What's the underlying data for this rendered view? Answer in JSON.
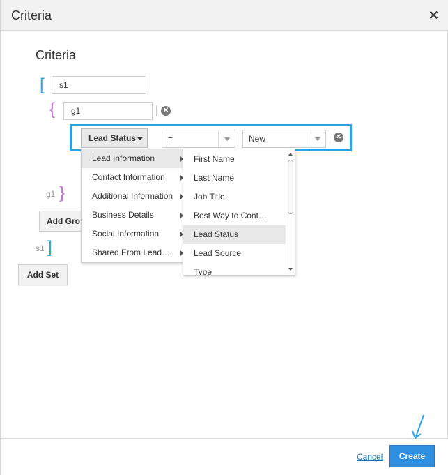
{
  "dialog": {
    "title": "Criteria",
    "close_glyph": "✕"
  },
  "section_title": "Criteria",
  "set": {
    "open_bracket": "[",
    "close_bracket": "]",
    "name_value": "s1",
    "end_label": "s1"
  },
  "group": {
    "open_bracket": "{",
    "close_bracket": "}",
    "name_value": "g1",
    "end_label": "g1",
    "remove_glyph": "✕"
  },
  "rule": {
    "field_label": "Lead Status",
    "operator_value": "=",
    "value_value": "New",
    "remove_glyph": "✕"
  },
  "category_menu": {
    "items": [
      {
        "label": "Lead Information",
        "active": true
      },
      {
        "label": "Contact Information",
        "active": false
      },
      {
        "label": "Additional Information",
        "active": false
      },
      {
        "label": "Business Details",
        "active": false
      },
      {
        "label": "Social Information",
        "active": false
      },
      {
        "label": "Shared From Lead…",
        "active": false
      }
    ]
  },
  "field_menu": {
    "items": [
      {
        "label": "First Name",
        "active": false
      },
      {
        "label": "Last Name",
        "active": false
      },
      {
        "label": "Job Title",
        "active": false
      },
      {
        "label": "Best Way to Cont…",
        "active": false
      },
      {
        "label": "Lead Status",
        "active": true
      },
      {
        "label": "Lead Source",
        "active": false
      },
      {
        "label": "Type",
        "active": false
      }
    ]
  },
  "buttons": {
    "add_group": "Add Gro",
    "add_set": "Add Set",
    "cancel": "Cancel",
    "create": "Create"
  },
  "colors": {
    "accent_blue": "#2aa3e8",
    "group_purple": "#c36ad6",
    "primary_button": "#2f8fe0"
  },
  "icons": {
    "close": "close-icon",
    "remove": "remove-circle-icon",
    "dropdown": "caret-down-icon",
    "submenu": "chevron-right-icon",
    "annotation": "arrow-pointer-icon"
  }
}
